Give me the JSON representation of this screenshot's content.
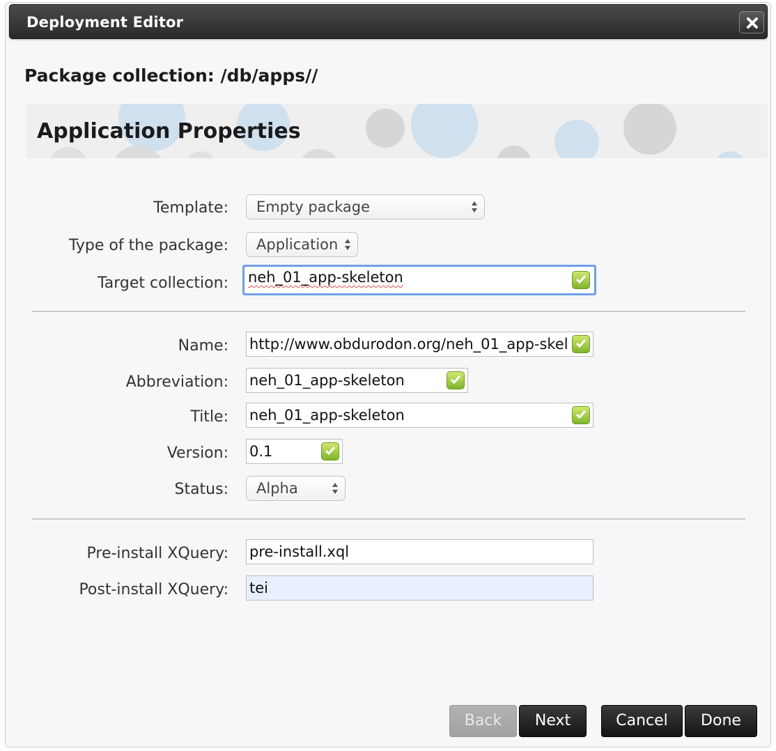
{
  "window": {
    "title": "Deployment Editor",
    "close_icon": "close-icon"
  },
  "package_collection": "Package collection: /db/apps//",
  "section_heading": "Application Properties",
  "fields": {
    "template": {
      "label": "Template:",
      "value": "Empty package"
    },
    "package_type": {
      "label": "Type of the package:",
      "value": "Application"
    },
    "target_collection": {
      "label": "Target collection:",
      "value": "neh_01_app-skeleton"
    },
    "name": {
      "label": "Name:",
      "value": "http://www.obdurodon.org/neh_01_app-skel"
    },
    "abbreviation": {
      "label": "Abbreviation:",
      "value": "neh_01_app-skeleton"
    },
    "title": {
      "label": "Title:",
      "value": "neh_01_app-skeleton"
    },
    "version": {
      "label": "Version:",
      "value": "0.1"
    },
    "status": {
      "label": "Status:",
      "value": "Alpha"
    },
    "pre_install": {
      "label": "Pre-install XQuery:",
      "value": "pre-install.xql"
    },
    "post_install": {
      "label": "Post-install XQuery:",
      "value": "tei"
    }
  },
  "buttons": {
    "back": "Back",
    "next": "Next",
    "cancel": "Cancel",
    "done": "Done"
  },
  "colors": {
    "titlebar": "#2f2f2f",
    "focus_border": "#6f9ee8",
    "valid_check": "#7fb42d",
    "button_dark": "#1c1c1c",
    "button_disabled": "#a9a9a9"
  }
}
